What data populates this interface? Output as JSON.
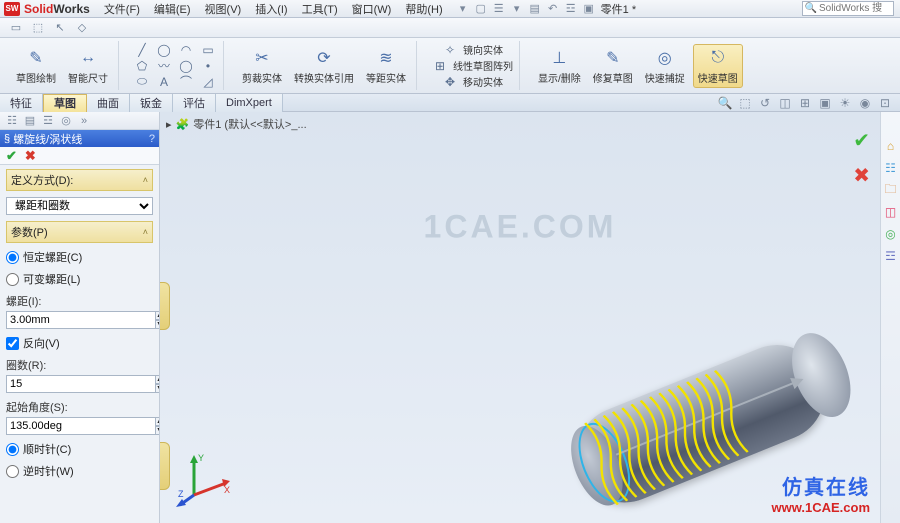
{
  "app": {
    "brand_prefix": "Solid",
    "brand_suffix": "Works",
    "doc_title": "零件1 *",
    "search_placeholder": "SolidWorks 搜"
  },
  "menu": {
    "file": "文件(F)",
    "edit": "编辑(E)",
    "view": "视图(V)",
    "insert": "插入(I)",
    "tools": "工具(T)",
    "window": "窗口(W)",
    "help": "帮助(H)"
  },
  "ribbon": {
    "sketch": "草图绘制",
    "smart_dim": "智能尺寸",
    "trim": "剪裁实体",
    "convert": "转换实体引用",
    "offset": "等距实体",
    "mirror": "镜向实体",
    "pattern": "线性草图阵列",
    "move": "移动实体",
    "display": "显示/删除",
    "repair": "修复草图",
    "quick": "快速捕捉",
    "exit": "快速草图"
  },
  "tabs": {
    "feature": "特征",
    "sketch": "草图",
    "surface": "曲面",
    "sheet": "钣金",
    "evaluate": "评估",
    "dimxpert": "DimXpert"
  },
  "breadcrumb": {
    "prefix": "零件1 (默认<<默认>_..."
  },
  "pm": {
    "title": "螺旋线/涡状线",
    "help": "?",
    "define_by": "定义方式(D):",
    "define_sel": "螺距和圈数",
    "params": "参数(P)",
    "const": "恒定螺距(C)",
    "var": "可变螺距(L)",
    "pitch_l": "螺距(I):",
    "pitch_v": "3.00mm",
    "reverse": "反向(V)",
    "rev_l": "圈数(R):",
    "rev_v": "15",
    "ang_l": "起始角度(S):",
    "ang_v": "135.00deg",
    "cw": "顺时针(C)",
    "ccw": "逆时针(W)"
  },
  "watermark": {
    "center": "1CAE.COM",
    "cn": "仿真在线",
    "url": "www.1CAE.com"
  }
}
